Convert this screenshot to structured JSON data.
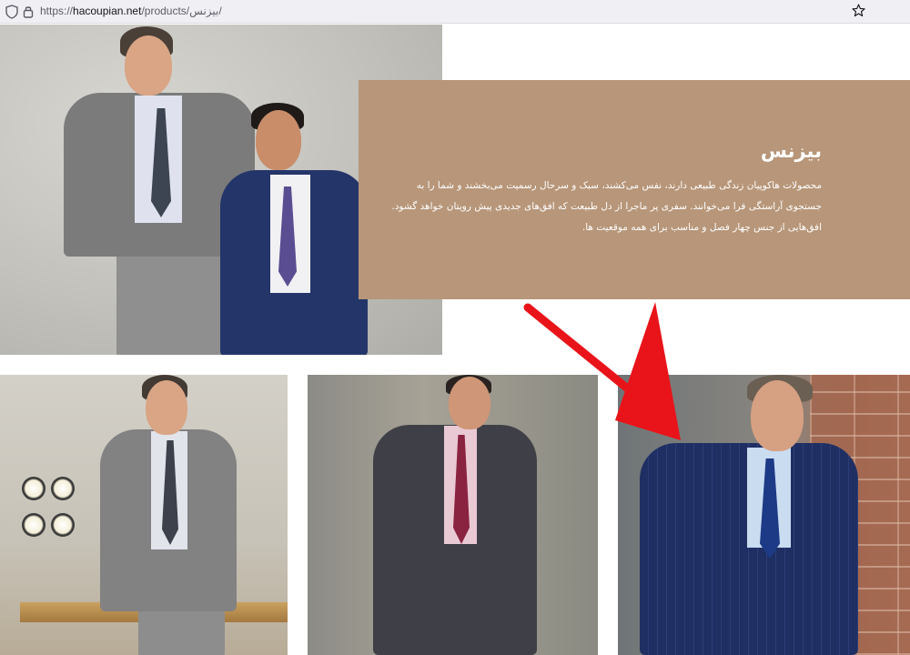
{
  "browser": {
    "url_prefix": "https://",
    "url_host": "hacoupian.net",
    "url_path": "/products/بیزنس/"
  },
  "panel": {
    "title": "بیزنس",
    "lines": [
      "محصولات هاکوپیان زندگی طبیعی دارند، نفس می‌کشند، سبک و سرحال رسمیت می‌بخشند و شما را به",
      "جستجوی آراستگی فرا می‌خوانند. سفری پر ماجرا از دل طبیعت که افق‌های جدیدی پیش رویتان خواهد گشود.",
      "افق‌هایی از جنس چهار فصل و مناسب برای همه موقعیت ها."
    ]
  },
  "icons": {
    "tracking_protection": "shield-icon",
    "security": "lock-icon",
    "bookmark": "star-icon",
    "annotation": "red-arrow-icon"
  },
  "colors": {
    "panel_bg": "#b79679",
    "arrow": "#e8141a"
  }
}
